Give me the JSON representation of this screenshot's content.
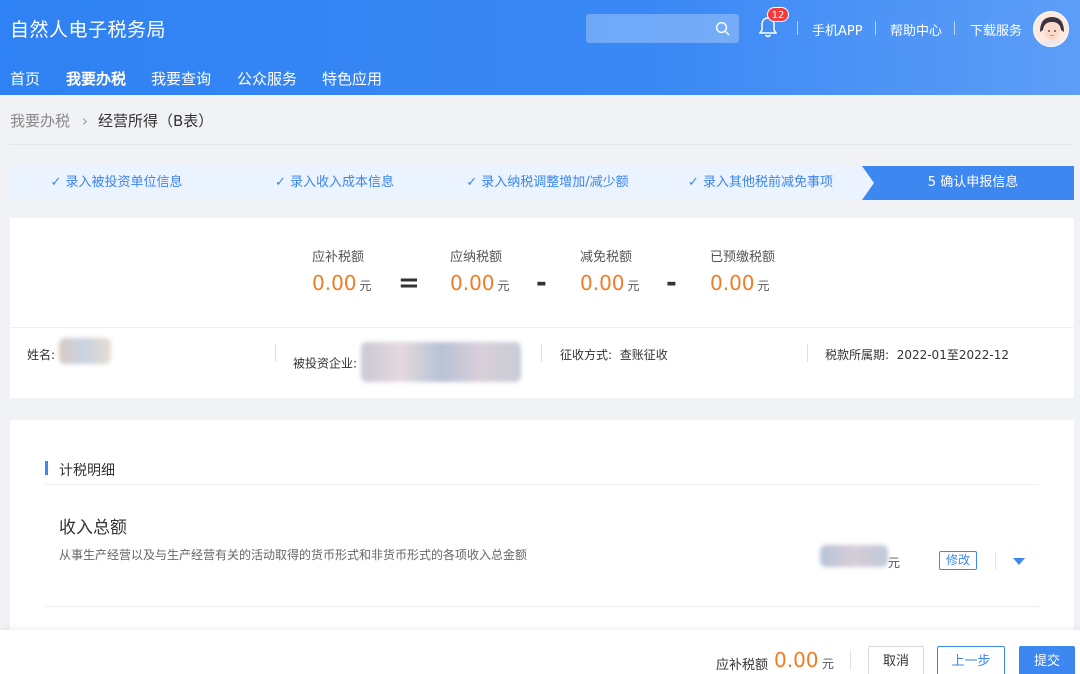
{
  "header": {
    "logo": "自然人电子税务局",
    "search_placeholder": "",
    "badge_count": "12",
    "links": [
      "手机APP",
      "帮助中心",
      "下载服务"
    ]
  },
  "nav": {
    "items": [
      "首页",
      "我要办税",
      "我要查询",
      "公众服务",
      "特色应用"
    ],
    "active_index": 1
  },
  "breadcrumb": {
    "parent": "我要办税",
    "current": "经营所得（B表）"
  },
  "steps": [
    {
      "label": "录入被投资单位信息",
      "done": true
    },
    {
      "label": "录入收入成本信息",
      "done": true
    },
    {
      "label": "录入纳税调整增加/减少额",
      "done": true
    },
    {
      "label": "录入其他税前减免事项",
      "done": true
    },
    {
      "label": "5  确认申报信息",
      "done": false,
      "active": true
    }
  ],
  "summary": {
    "payable": {
      "label": "应补税额",
      "value": "0.00",
      "unit": "元"
    },
    "eq": "=",
    "tax_due": {
      "label": "应纳税额",
      "value": "0.00",
      "unit": "元"
    },
    "minus1": "-",
    "tax_relief": {
      "label": "减免税额",
      "value": "0.00",
      "unit": "元"
    },
    "minus2": "-",
    "prepaid": {
      "label": "已预缴税额",
      "value": "0.00",
      "unit": "元"
    },
    "info": {
      "name_label": "姓名:",
      "enterprise_label": "被投资企业:",
      "collection_label": "征收方式:",
      "collection_value": "查账征收",
      "period_label": "税款所属期:",
      "period_value": "2022-01至2022-12"
    }
  },
  "detail": {
    "section_title": "计税明细",
    "item_title": "收入总额",
    "item_desc": "从事生产经营以及与生产经营有关的活动取得的货币形式和非货币形式的各项收入总金额",
    "item_unit": "元",
    "edit_label": "修改"
  },
  "footer": {
    "label": "应补税额",
    "value": "0.00",
    "unit": "元",
    "cancel": "取消",
    "prev": "上一步",
    "submit": "提交"
  },
  "colors": {
    "brand": "#3d87f0",
    "amount": "#f07d26"
  }
}
